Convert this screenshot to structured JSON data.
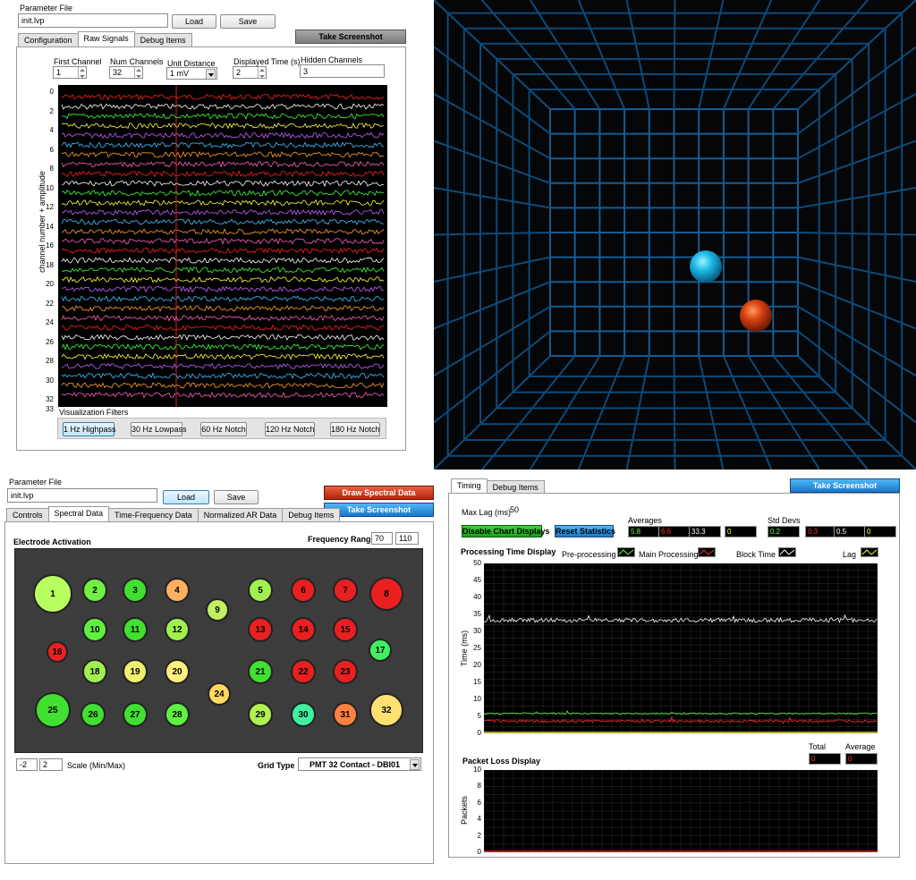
{
  "q1": {
    "param_label": "Parameter File",
    "param_file": "init.lvp",
    "load_label": "Load",
    "save_label": "Save",
    "screenshot_label": "Take Screenshot",
    "tabs": [
      "Configuration",
      "Raw Signals",
      "Debug Items"
    ],
    "controls": {
      "first_channel_label": "First Channel",
      "first_channel": "1",
      "num_channels_label": "Num Channels",
      "num_channels": "32",
      "unit_distance_label": "Unit Distance",
      "unit_distance": "1 mV",
      "displayed_time_label": "Displayed Time (s)",
      "displayed_time": "2",
      "hidden_channels_label": "Hidden Channels",
      "hidden_channels": "3"
    },
    "ylabel": "channel number + amplitude",
    "yticks": [
      "0",
      "2",
      "4",
      "6",
      "8",
      "10",
      "12",
      "14",
      "16",
      "18",
      "20",
      "22",
      "24",
      "26",
      "28",
      "30",
      "32",
      "33"
    ],
    "filters_label": "Visualization Filters",
    "filters": [
      "1 Hz Highpass",
      "30 Hz Lowpass",
      "60 Hz Notch",
      "120 Hz Notch",
      "180 Hz Notch"
    ],
    "trace_colors": [
      "#ff2020",
      "#ffffff",
      "#40ff40",
      "#ffff40",
      "#c060ff",
      "#40c0ff",
      "#ffa030",
      "#ff60c0"
    ]
  },
  "q3": {
    "param_label": "Parameter File",
    "param_file": "init.lvp",
    "load_label": "Load",
    "save_label": "Save",
    "draw_label": "Draw Spectral Data",
    "screenshot_label": "Take Screenshot",
    "tabs": [
      "Controls",
      "Spectral Data",
      "Time-Frequency Data",
      "Normalized AR Data",
      "Debug Items"
    ],
    "electrode_label": "Electrode Activation",
    "freq_label": "Frequency Range",
    "freq_min": "70",
    "freq_max": "110",
    "scale_min": "-2",
    "scale_max": "2",
    "scale_label": "Scale (Min/Max)",
    "grid_type_label": "Grid Type",
    "grid_type": "PMT 32 Contact - DBI01",
    "electrodes": [
      {
        "n": "1",
        "c": "#b8ff60"
      },
      {
        "n": "2",
        "c": "#70f040"
      },
      {
        "n": "3",
        "c": "#40e030"
      },
      {
        "n": "4",
        "c": "#ffb060"
      },
      {
        "n": "5",
        "c": "#a0f050"
      },
      {
        "n": "6",
        "c": "#e82020"
      },
      {
        "n": "7",
        "c": "#e82020"
      },
      {
        "n": "8",
        "c": "#e82020"
      },
      {
        "n": "9",
        "c": "#c0f060"
      },
      {
        "n": "10",
        "c": "#60f040"
      },
      {
        "n": "11",
        "c": "#40e030"
      },
      {
        "n": "12",
        "c": "#a0f050"
      },
      {
        "n": "13",
        "c": "#e82020"
      },
      {
        "n": "14",
        "c": "#e82020"
      },
      {
        "n": "15",
        "c": "#e82020"
      },
      {
        "n": "16",
        "c": "#e82020"
      },
      {
        "n": "17",
        "c": "#40f060"
      },
      {
        "n": "18",
        "c": "#a0f050"
      },
      {
        "n": "19",
        "c": "#f0f070"
      },
      {
        "n": "20",
        "c": "#fff080"
      },
      {
        "n": "21",
        "c": "#40e030"
      },
      {
        "n": "22",
        "c": "#e82020"
      },
      {
        "n": "23",
        "c": "#e82020"
      },
      {
        "n": "24",
        "c": "#ffd860"
      },
      {
        "n": "25",
        "c": "#40e030"
      },
      {
        "n": "26",
        "c": "#40e030"
      },
      {
        "n": "27",
        "c": "#40e030"
      },
      {
        "n": "28",
        "c": "#60f040"
      },
      {
        "n": "29",
        "c": "#b0f050"
      },
      {
        "n": "30",
        "c": "#40f0a0"
      },
      {
        "n": "31",
        "c": "#ff8040"
      },
      {
        "n": "32",
        "c": "#ffe070"
      }
    ]
  },
  "q4": {
    "tabs": [
      "Timing",
      "Debug Items"
    ],
    "screenshot_label": "Take Screenshot",
    "max_lag_label": "Max Lag (ms)",
    "max_lag": "50",
    "disable_label": "Disable Chart Displays",
    "reset_label": "Reset Statistics",
    "averages_label": "Averages",
    "averages": [
      {
        "v": "5.8",
        "c": "#60ff40"
      },
      {
        "v": "6.6",
        "c": "#ff3030"
      },
      {
        "v": "33.3",
        "c": "#ffffff"
      },
      {
        "v": "0",
        "c": "#ffff40"
      }
    ],
    "stddevs_label": "Std Devs",
    "stddevs": [
      {
        "v": "0.2",
        "c": "#60ff40"
      },
      {
        "v": "0.3",
        "c": "#ff3030"
      },
      {
        "v": "0.5",
        "c": "#ffffff"
      },
      {
        "v": "0",
        "c": "#ffff40"
      }
    ],
    "proc_title": "Processing Time Display",
    "legend": [
      {
        "label": "Pre-processing",
        "c": "#60ff40"
      },
      {
        "label": "Main Processing",
        "c": "#ff3030"
      },
      {
        "label": "Block Time",
        "c": "#ffffff"
      },
      {
        "label": "Lag",
        "c": "#ffff40"
      }
    ],
    "proc_ylabel": "Time (ms)",
    "proc_yticks": [
      "50",
      "45",
      "40",
      "35",
      "30",
      "25",
      "20",
      "15",
      "10",
      "5",
      "0"
    ],
    "total_label": "Total",
    "average_label": "Average",
    "total": "0",
    "average": "0",
    "loss_title": "Packet Loss Display",
    "loss_ylabel": "Packets",
    "loss_yticks": [
      "10",
      "8",
      "6",
      "4",
      "2",
      "0"
    ]
  }
}
